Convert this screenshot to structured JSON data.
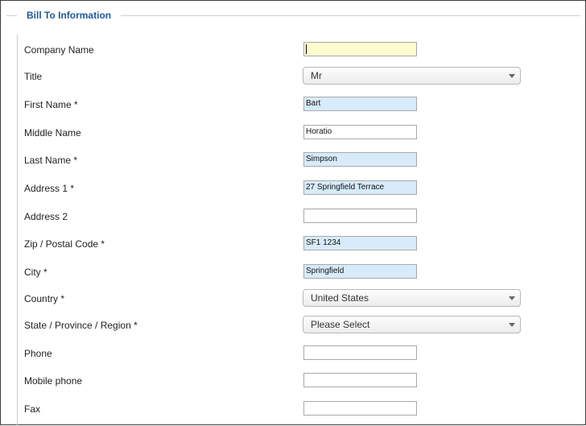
{
  "legend": "Bill To Information",
  "fields": [
    {
      "label": "Company Name",
      "type": "text",
      "value": "",
      "state": "focused"
    },
    {
      "label": "Title",
      "type": "select",
      "value": "Mr"
    },
    {
      "label": "First Name *",
      "type": "text",
      "value": "Bart",
      "state": "filled"
    },
    {
      "label": "Middle Name",
      "type": "text",
      "value": "Horatio",
      "state": "normal"
    },
    {
      "label": "Last Name *",
      "type": "text",
      "value": "Simpson",
      "state": "filled"
    },
    {
      "label": "Address 1 *",
      "type": "text",
      "value": "27 Springfield Terrace",
      "state": "filled"
    },
    {
      "label": "Address 2",
      "type": "text",
      "value": "",
      "state": "normal"
    },
    {
      "label": "Zip / Postal Code *",
      "type": "text",
      "value": "SF1 1234",
      "state": "filled"
    },
    {
      "label": "City *",
      "type": "text",
      "value": "Springfield",
      "state": "filled"
    },
    {
      "label": "Country *",
      "type": "select",
      "value": "United States"
    },
    {
      "label": "State / Province / Region *",
      "type": "select",
      "value": "Please Select"
    },
    {
      "label": "Phone",
      "type": "text",
      "value": "",
      "state": "normal"
    },
    {
      "label": "Mobile phone",
      "type": "text",
      "value": "",
      "state": "normal"
    },
    {
      "label": "Fax",
      "type": "text",
      "value": "",
      "state": "normal"
    }
  ],
  "colors": {
    "legend_text": "#1e5a9b",
    "filled_input_bg": "#d7ebfa",
    "focused_input_bg": "#fdfbd0"
  }
}
